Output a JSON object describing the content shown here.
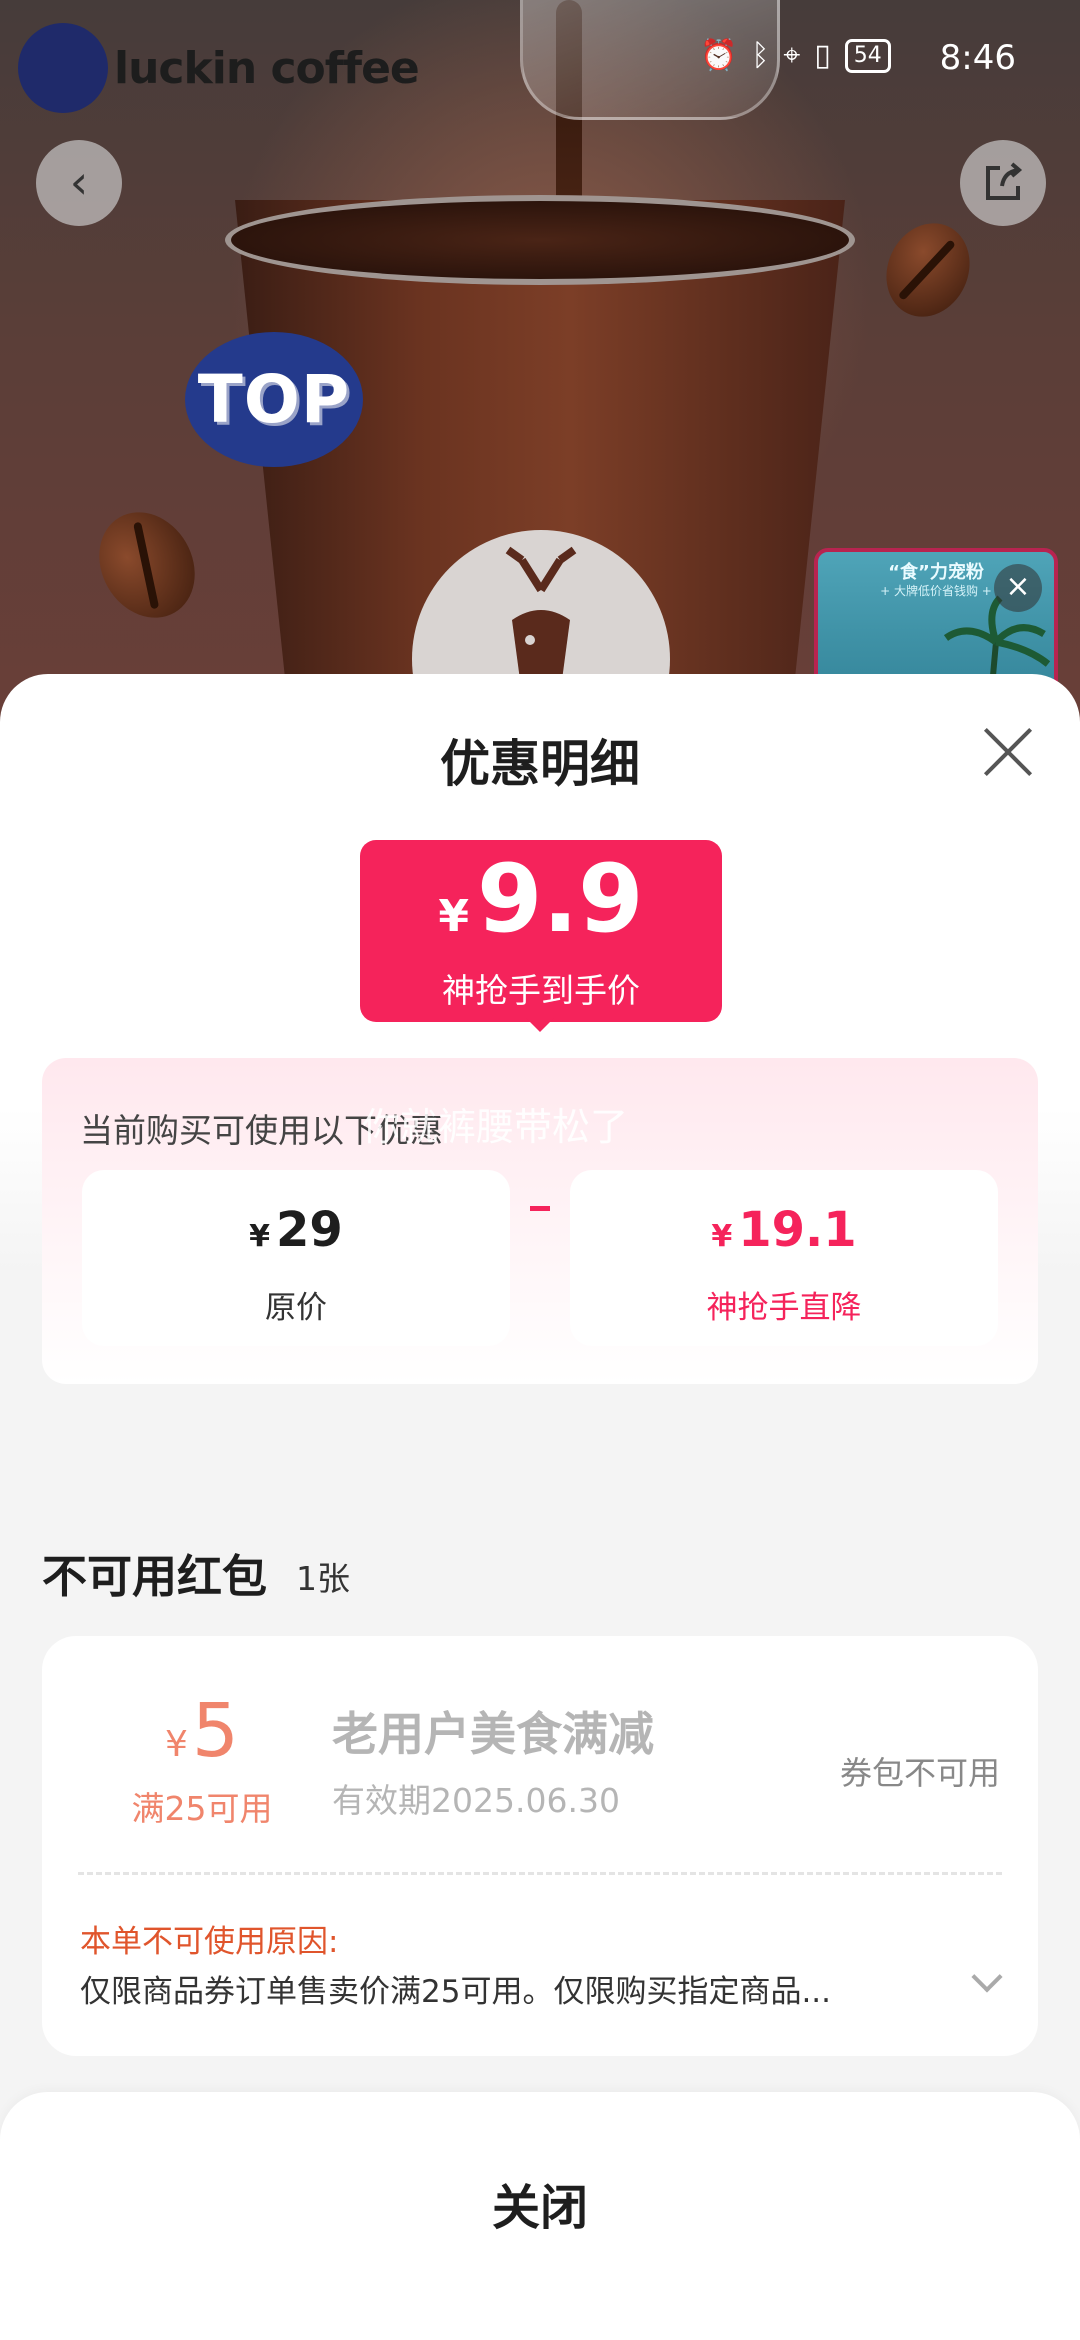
{
  "status_bar": {
    "brand": "luckin coffee",
    "battery": "54",
    "time": "8:46"
  },
  "hero": {
    "badge_text": "TOP",
    "promo_title": "“食”力宠粉",
    "promo_subtitle": "+ 大牌低价省钱购 +"
  },
  "sheet": {
    "title": "优惠明细",
    "final_price": {
      "currency": "¥",
      "amount": "9.9",
      "label": "神抢手到手价"
    },
    "discount_caption": "当前购买可使用以下优惠",
    "watermark": "你就裤腰带松了",
    "original": {
      "currency": "¥",
      "amount": "29",
      "label": "原价"
    },
    "reduction": {
      "currency": "¥",
      "amount": "19.1",
      "label": "神抢手直降"
    },
    "unavailable": {
      "title": "不可用红包",
      "count": "1张",
      "coupon": {
        "currency": "¥",
        "amount": "5",
        "condition": "满25可用",
        "name": "老用户美食满减",
        "validity": "有效期2025.06.30",
        "state": "券包不可用",
        "reason_title": "本单不可使用原因:",
        "reason": "仅限商品券订单售卖价满25可用。仅限购买指定商品..."
      }
    },
    "close_label": "关闭"
  },
  "colors": {
    "accent": "#f5235b",
    "coupon": "#f0856c",
    "reason": "#e0552c"
  }
}
